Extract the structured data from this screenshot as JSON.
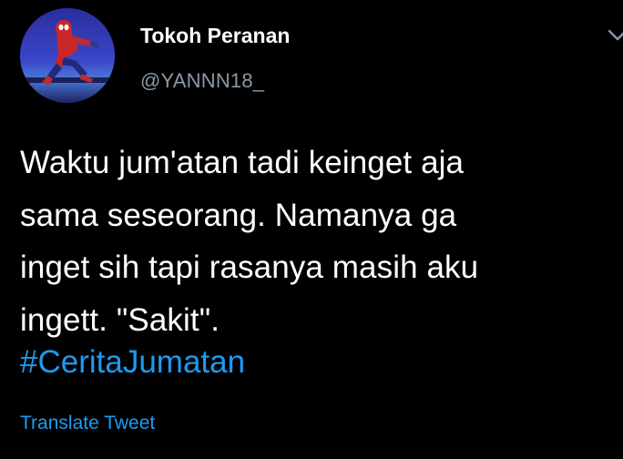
{
  "author": {
    "display_name": "Tokoh Peranan",
    "handle": "@YANNN18_"
  },
  "tweet": {
    "lines": [
      "Waktu jum'atan tadi keinget aja",
      "sama seseorang. Namanya ga",
      "inget sih tapi rasanya masih aku",
      "ingett. \"Sakit\"."
    ],
    "hashtag": "#CeritaJumatan",
    "translate_label": "Translate Tweet"
  },
  "colors": {
    "background": "#000000",
    "text": "#ffffff",
    "secondary": "#8b98a5",
    "link": "#1d9bf0"
  },
  "icons": {
    "menu": "chevron-down-icon",
    "avatar": "spiderman-avatar"
  }
}
